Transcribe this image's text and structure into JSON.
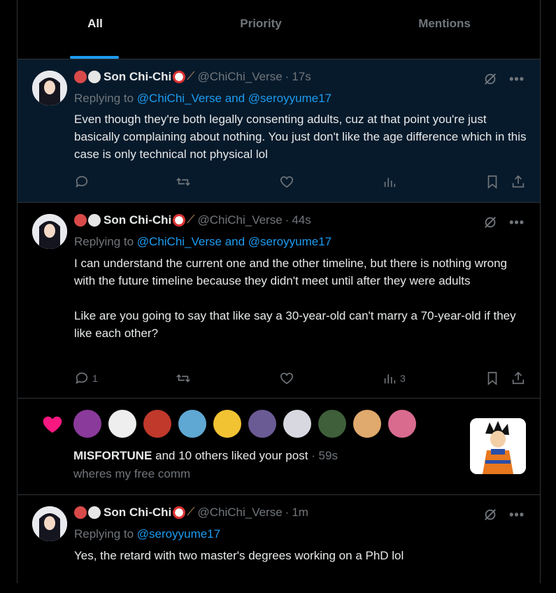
{
  "tabs": [
    {
      "label": "All"
    },
    {
      "label": "Priority"
    },
    {
      "label": "Mentions"
    }
  ],
  "posts": [
    {
      "name": "Son Chi-Chi",
      "handle": "@ChiChi_Verse",
      "time": "17s",
      "reply_prefix": "Replying to ",
      "reply_targets": "@ChiChi_Verse and @seroyyume17",
      "text": "Even though they're both legally consenting adults, cuz at that point you're just basically complaining about nothing. You just don't like the age difference which in this case is only technical not physical lol",
      "reply_count": "",
      "views": ""
    },
    {
      "name": "Son Chi-Chi",
      "handle": "@ChiChi_Verse",
      "time": "44s",
      "reply_prefix": "Replying to ",
      "reply_targets": "@ChiChi_Verse and @seroyyume17",
      "text": "I can understand the current one and the other timeline, but there is nothing wrong with the future timeline because they didn't meet until after they were adults\n\nLike are you going to say that like say a 30-year-old can't marry a 70-year-old if they like each other?",
      "reply_count": "1",
      "views": "3"
    },
    {
      "name": "Son Chi-Chi",
      "handle": "@ChiChi_Verse",
      "time": "1m",
      "reply_prefix": "Replying to ",
      "reply_targets": "@seroyyume17",
      "text": "Yes, the retard with two master's degrees working on a PhD lol"
    }
  ],
  "notification": {
    "actor": "MISFORTUNE",
    "rest": " and 10 others liked your post",
    "time": "59s",
    "post_preview": "wheres my free comm"
  },
  "colors": {
    "accent": "#1d9bf0",
    "like": "#f91880",
    "muted": "#71767b",
    "highlight_bg": "#071a2b"
  }
}
